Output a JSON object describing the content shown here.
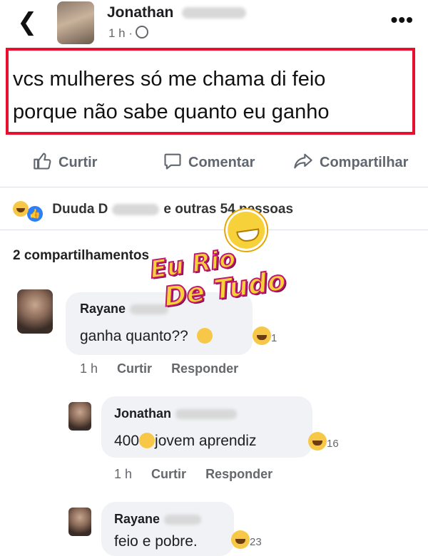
{
  "header": {
    "back_icon": "chevron-left-icon",
    "author_name": "Jonathan",
    "time": "1 h ·",
    "privacy_icon": "globe-icon",
    "more_icon": "more-horizontal-icon"
  },
  "post": {
    "line1": "vcs mulheres só me chama di feio",
    "line2": "porque não sabe quanto eu ganho",
    "highlight_color": "#e8102e"
  },
  "actions": {
    "like": "Curtir",
    "comment": "Comentar",
    "share": "Compartilhar"
  },
  "reactions_summary": {
    "name": "Duuda D",
    "text": "e outras 54 pessoas",
    "icons": [
      "haha-reaction-icon",
      "like-reaction-icon"
    ]
  },
  "shares_text": "2 compartilhamentos",
  "watermark": {
    "line1": "Eu Rio",
    "line2": "De Tudo"
  },
  "comments": [
    {
      "author": "Rayane",
      "text": "ganha quanto??",
      "emoji": "thinking-face-icon",
      "reaction_count": "1",
      "time": "1 h",
      "like_label": "Curtir",
      "reply_label": "Responder"
    },
    {
      "author": "Jonathan",
      "text_before": "400",
      "emoji": "unamused-face-icon",
      "text_after": "jovem aprendiz",
      "reaction_count": "16",
      "time": "1 h",
      "like_label": "Curtir",
      "reply_label": "Responder"
    },
    {
      "author": "Rayane",
      "text": "feio e pobre.",
      "reaction_count": "23"
    }
  ]
}
